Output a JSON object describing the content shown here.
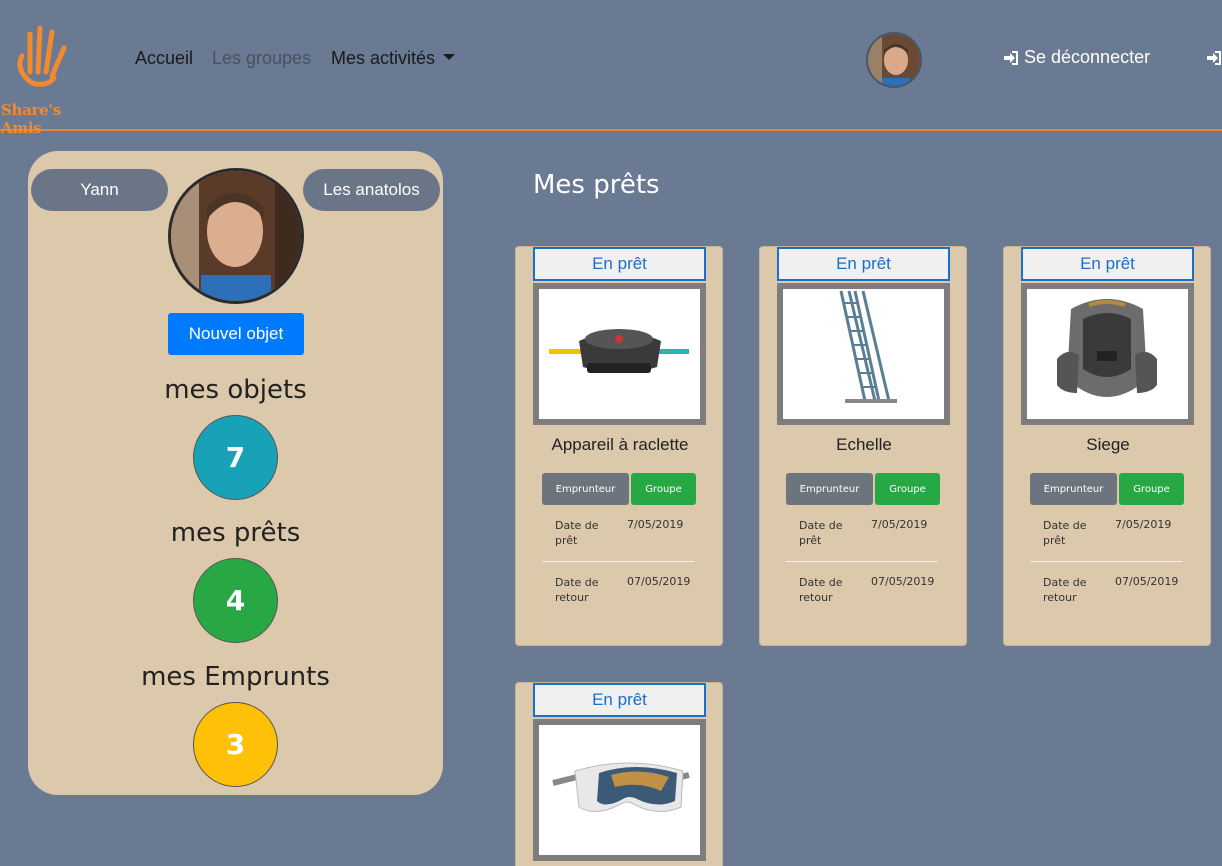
{
  "navbar": {
    "logo_text": "Share's Amis",
    "links": [
      {
        "label": "Accueil"
      },
      {
        "label": "Les groupes"
      },
      {
        "label": "Mes activités"
      }
    ],
    "logout_label": "Se déconnecter",
    "accent_color": "#e8853c"
  },
  "profile": {
    "name": "Yann",
    "group": "Les anatolos",
    "new_object_label": "Nouvel objet",
    "stats": [
      {
        "label": "mes objets",
        "value": "7",
        "color": "#17a2b8"
      },
      {
        "label": "mes prêts",
        "value": "4",
        "color": "#28a745"
      },
      {
        "label": "mes Emprunts",
        "value": "3",
        "color": "#ffc107"
      }
    ]
  },
  "main": {
    "title": "Mes prêts",
    "cards": [
      {
        "status": "En prêt",
        "title": "Appareil à raclette",
        "image": "raclette-grill",
        "borrower_label": "Emprunteur",
        "group_label": "Groupe",
        "loan_date_label": "Date de prêt",
        "loan_date": "7/05/2019",
        "return_date_label": "Date de retour",
        "return_date": "07/05/2019"
      },
      {
        "status": "En prêt",
        "title": "Echelle",
        "image": "ladder",
        "borrower_label": "Emprunteur",
        "group_label": "Groupe",
        "loan_date_label": "Date de prêt",
        "loan_date": "7/05/2019",
        "return_date_label": "Date de retour",
        "return_date": "07/05/2019"
      },
      {
        "status": "En prêt",
        "title": "Siege",
        "image": "car-seat",
        "borrower_label": "Emprunteur",
        "group_label": "Groupe",
        "loan_date_label": "Date de prêt",
        "loan_date": "7/05/2019",
        "return_date_label": "Date de retour",
        "return_date": "07/05/2019"
      },
      {
        "status": "En prêt",
        "image": "ski-goggles"
      }
    ]
  }
}
